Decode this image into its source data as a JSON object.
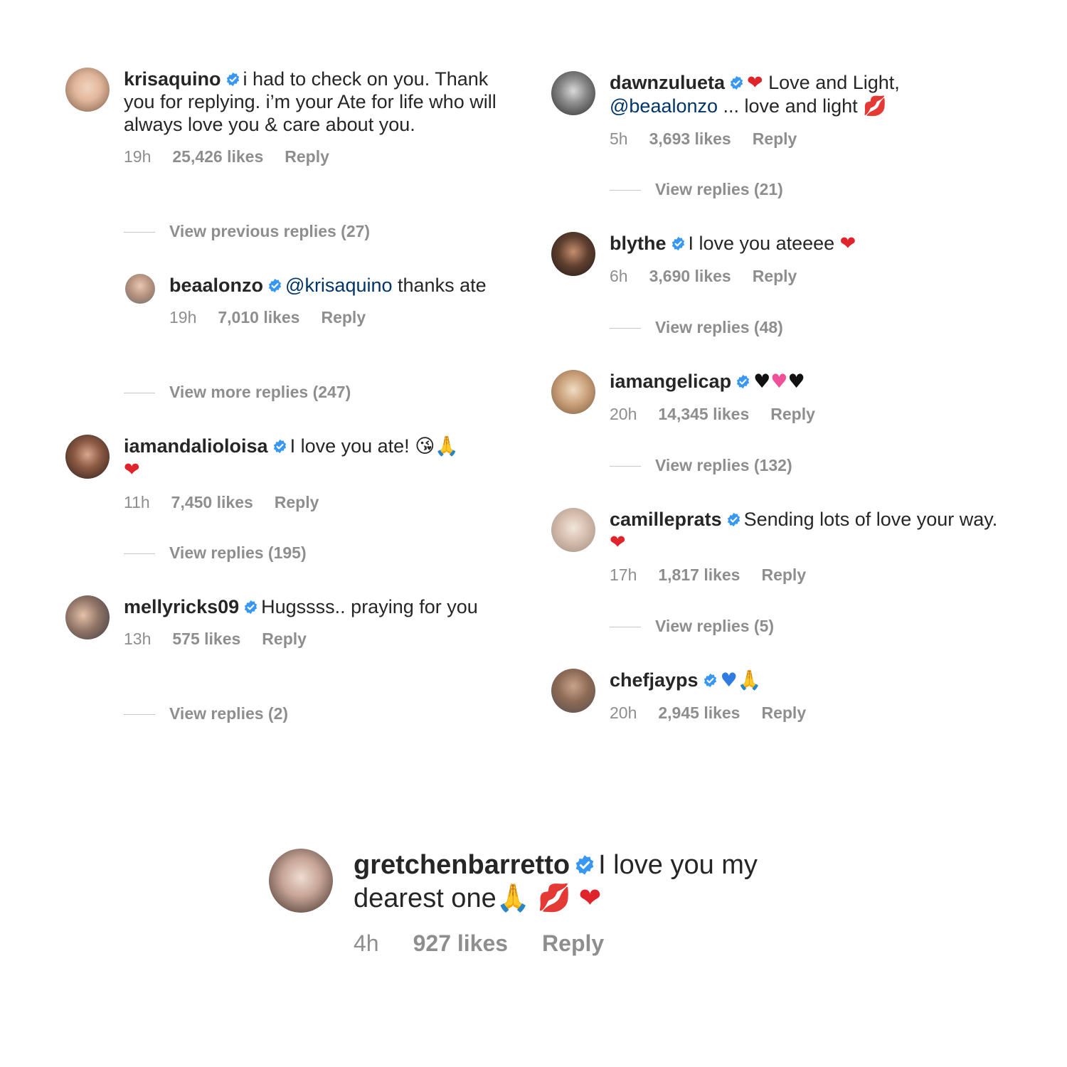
{
  "comments": [
    {
      "user": "krisaquino",
      "text": "i had to check on you. Thank you for replying. i’m your Ate for life who will always love you & care about you.",
      "time": "19h",
      "likes": "25,426 likes",
      "reply": "Reply"
    },
    {
      "user": "beaalonzo",
      "mention": "@krisaquino",
      "text": " thanks ate",
      "time": "19h",
      "likes": "7,010 likes",
      "reply": "Reply"
    },
    {
      "user": "iamandalioloisa",
      "text": "I love you ate! ",
      "time": "11h",
      "likes": "7,450 likes",
      "reply": "Reply"
    },
    {
      "user": "mellyricks09",
      "text": "Hugssss.. praying for you",
      "time": "13h",
      "likes": "575 likes",
      "reply": "Reply"
    },
    {
      "user": "dawnzulueta",
      "text": " Love and Light, ",
      "mention": "@beaalonzo",
      "text2": " ... love and light ",
      "time": "5h",
      "likes": "3,693 likes",
      "reply": "Reply"
    },
    {
      "user": "blythe",
      "text": "I love you ateeee ",
      "time": "6h",
      "likes": "3,690 likes",
      "reply": "Reply"
    },
    {
      "user": "iamangelicap",
      "time": "20h",
      "likes": "14,345 likes",
      "reply": "Reply"
    },
    {
      "user": "camilleprats",
      "text": "Sending lots of love your way. ",
      "time": "17h",
      "likes": "1,817 likes",
      "reply": "Reply"
    },
    {
      "user": "chefjayps",
      "time": "20h",
      "likes": "2,945 likes",
      "reply": "Reply"
    },
    {
      "user": "gretchenbarretto",
      "text": "I love you my dearest one",
      "time": "4h",
      "likes": "927 likes",
      "reply": "Reply"
    }
  ],
  "view_replies": {
    "v1": "View previous replies (27)",
    "v2": "View more replies (247)",
    "v3": "View replies (195)",
    "v4": "View replies (2)",
    "v5": "View replies (21)",
    "v6": "View replies (48)",
    "v7": "View replies (132)",
    "v8": "View replies (5)"
  },
  "emoji": {
    "heart": "❤",
    "black_heart": "♥",
    "growing_heart": "♥",
    "blue_heart": "♥",
    "kiss_mark": "💋",
    "kiss_face": "😘",
    "pray": "🙏"
  },
  "colors": {
    "text": "#262626",
    "meta": "#8e8e8e",
    "mention": "#003569",
    "verified": "#3897f0",
    "heart": "#e0242c"
  }
}
